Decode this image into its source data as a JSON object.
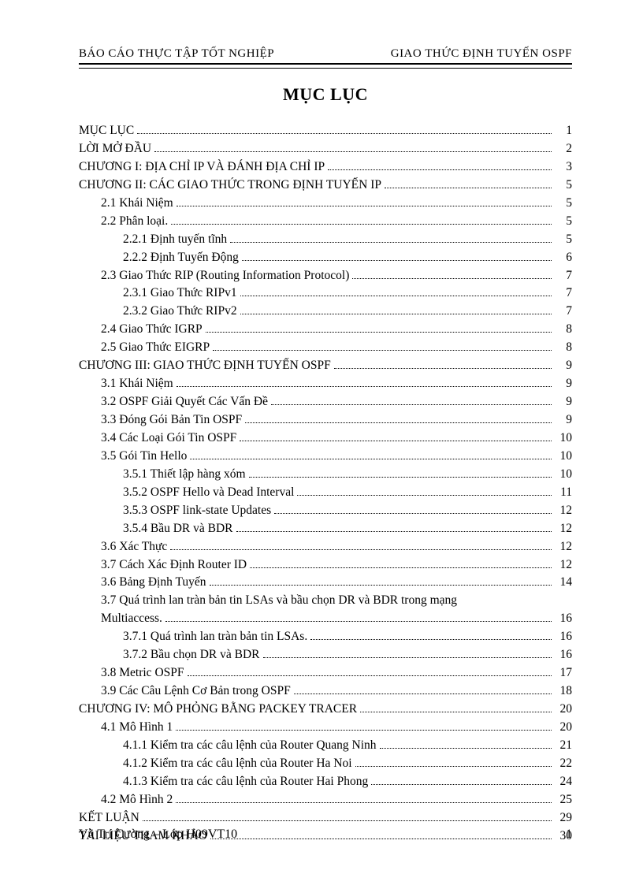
{
  "header": {
    "left": "BÁO CÁO THỰC TẬP TỐT NGHIỆP",
    "right": "GIAO THỨC ĐỊNH TUYẾN OSPF"
  },
  "title": "MỤC LỤC",
  "toc": [
    {
      "label": "MỤC LỤC",
      "page": "1",
      "indent": 0
    },
    {
      "label": "LỜI MỞ ĐẦU",
      "page": "2",
      "indent": 0
    },
    {
      "label": "CHƯƠNG I: ĐỊA CHỈ IP VÀ ĐÁNH ĐỊA CHỈ IP",
      "page": "3",
      "indent": 0
    },
    {
      "label": "CHƯƠNG II: CÁC GIAO THỨC TRONG ĐỊNH TUYẾN IP",
      "page": "5",
      "indent": 0
    },
    {
      "label": "2.1 Khái Niệm",
      "page": "5",
      "indent": 1
    },
    {
      "label": "2.2 Phân loại.",
      "page": "5",
      "indent": 1
    },
    {
      "label": "2.2.1 Định tuyến tĩnh",
      "page": "5",
      "indent": 2
    },
    {
      "label": "2.2.2 Định Tuyến Động",
      "page": "6",
      "indent": 2
    },
    {
      "label": "2.3 Giao Thức RIP (Routing Information Protocol)",
      "page": "7",
      "indent": 1
    },
    {
      "label": "2.3.1 Giao Thức RIPv1",
      "page": "7",
      "indent": 2
    },
    {
      "label": "2.3.2 Giao Thức RIPv2",
      "page": "7",
      "indent": 2
    },
    {
      "label": "2.4 Giao Thức IGRP",
      "page": "8",
      "indent": 1
    },
    {
      "label": "2.5 Giao Thức EIGRP",
      "page": "8",
      "indent": 1
    },
    {
      "label": "CHƯƠNG III:  GIAO THỨC ĐỊNH TUYẾN OSPF",
      "page": "9",
      "indent": 0
    },
    {
      "label": "3.1 Khái Niệm",
      "page": "9",
      "indent": 1
    },
    {
      "label": "3.2 OSPF Giải Quyết Các Vấn Đề",
      "page": "9",
      "indent": 1
    },
    {
      "label": "3.3 Đóng Gói Bản Tin OSPF",
      "page": "9",
      "indent": 1
    },
    {
      "label": "3.4 Các Loại Gói Tin OSPF",
      "page": "10",
      "indent": 1
    },
    {
      "label": "3.5 Gói Tin Hello",
      "page": "10",
      "indent": 1
    },
    {
      "label": "3.5.1 Thiết lập hàng xóm",
      "page": "10",
      "indent": 2
    },
    {
      "label": "3.5.2 OSPF Hello và Dead Interval",
      "page": "11",
      "indent": 2
    },
    {
      "label": "3.5.3 OSPF link-state Updates",
      "page": "12",
      "indent": 2
    },
    {
      "label": "3.5.4 Bầu DR và BDR",
      "page": "12",
      "indent": 2
    },
    {
      "label": "3.6 Xác Thực",
      "page": "12",
      "indent": 1
    },
    {
      "label": "3.7 Cách Xác Định Router ID",
      "page": "12",
      "indent": 1
    },
    {
      "label": "3.6 Bảng Định Tuyến",
      "page": "14",
      "indent": 1
    },
    {
      "label": "3.7 Quá trình lan tràn bản tin LSAs và bầu chọn DR và BDR trong mạng",
      "page": "",
      "indent": 1,
      "nodots": true
    },
    {
      "label": "Multiaccess.",
      "page": "16",
      "indent": 1
    },
    {
      "label": "3.7.1 Quá trình lan tràn bản tin LSAs.",
      "page": "16",
      "indent": 2
    },
    {
      "label": "3.7.2 Bầu chọn DR và BDR",
      "page": "16",
      "indent": 2
    },
    {
      "label": "3.8 Metric OSPF",
      "page": "17",
      "indent": 1
    },
    {
      "label": "3.9 Các Câu Lệnh Cơ Bản trong OSPF",
      "page": "18",
      "indent": 1
    },
    {
      "label": "CHƯƠNG IV: MÔ PHỎNG BẰNG PACKEY TRACER",
      "page": "20",
      "indent": 0
    },
    {
      "label": "4.1 Mô Hình 1",
      "page": "20",
      "indent": 1
    },
    {
      "label": "4.1.1 Kiểm tra các câu lệnh của Router Quang Ninh",
      "page": "21",
      "indent": 2
    },
    {
      "label": "4.1.2 Kiểm tra các câu lệnh của Router Ha Noi",
      "page": "22",
      "indent": 2
    },
    {
      "label": "4.1.3 Kiểm tra các câu lệnh của Router Hai Phong",
      "page": "24",
      "indent": 2
    },
    {
      "label": "4.2 Mô Hình 2",
      "page": "25",
      "indent": 1
    },
    {
      "label": "KẾT LUẬN",
      "page": "29",
      "indent": 0
    },
    {
      "label": "TÀI LIỆU THAM KHẢO",
      "page": "30",
      "indent": 0
    }
  ],
  "footer": {
    "author": "Vũ Trí Cường – Lớp H09VT10",
    "page_number": "1"
  }
}
